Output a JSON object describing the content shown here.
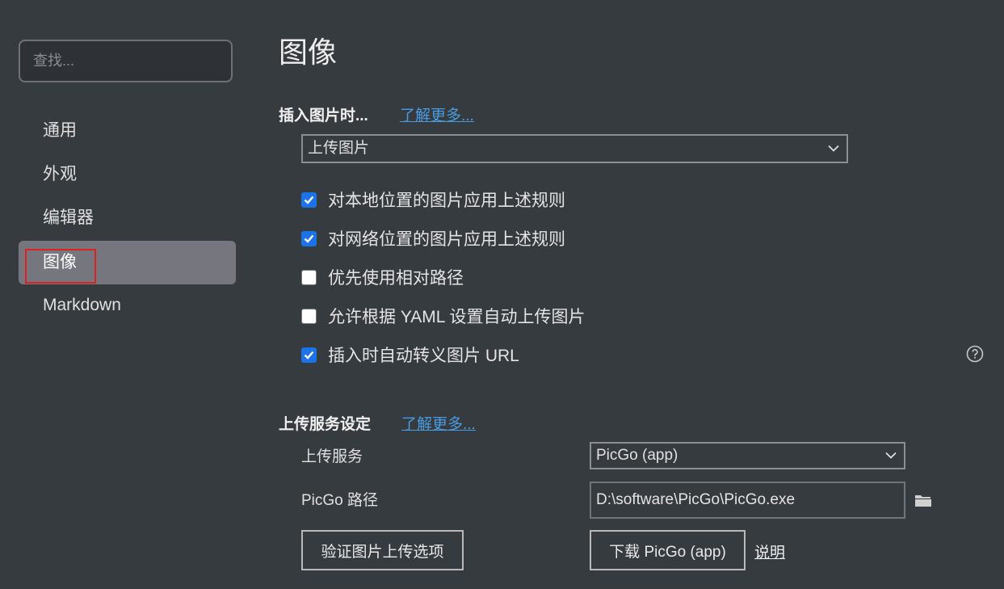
{
  "search": {
    "placeholder": "查找..."
  },
  "sidebar": {
    "items": [
      {
        "label": "通用"
      },
      {
        "label": "外观"
      },
      {
        "label": "编辑器"
      },
      {
        "label": "图像"
      },
      {
        "label": "Markdown"
      }
    ]
  },
  "main": {
    "title": "图像",
    "insert_section": {
      "title": "插入图片时...",
      "learn_more": "了解更多...",
      "action_select_value": "上传图片",
      "options": [
        {
          "label": "对本地位置的图片应用上述规则",
          "checked": true
        },
        {
          "label": "对网络位置的图片应用上述规则",
          "checked": true
        },
        {
          "label": "优先使用相对路径",
          "checked": false
        },
        {
          "label": "允许根据 YAML 设置自动上传图片",
          "checked": false
        },
        {
          "label": "插入时自动转义图片 URL",
          "checked": true
        }
      ]
    },
    "upload_section": {
      "title": "上传服务设定",
      "learn_more": "了解更多...",
      "service_label": "上传服务",
      "service_value": "PicGo (app)",
      "path_label": "PicGo 路径",
      "path_value": "D:\\software\\PicGo\\PicGo.exe",
      "verify_button": "验证图片上传选项",
      "download_button": "下载 PicGo (app)",
      "help_link": "说明"
    }
  },
  "colors": {
    "accent": "#1a73e8",
    "link": "#4a9be0",
    "active_item_bg": "#76767f",
    "highlight": "#e02020"
  }
}
